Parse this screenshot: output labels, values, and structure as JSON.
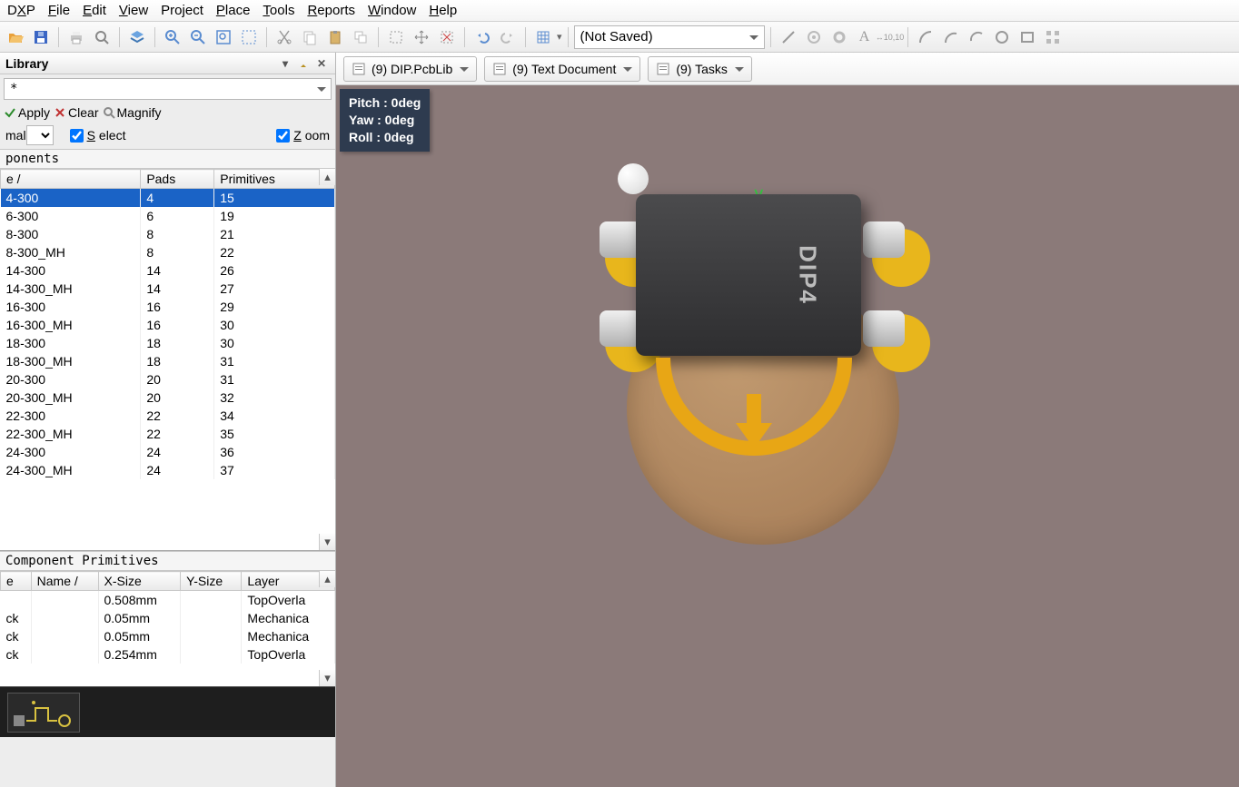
{
  "menu": {
    "items": [
      "DXP",
      "File",
      "Edit",
      "View",
      "Project",
      "Place",
      "Tools",
      "Reports",
      "Window",
      "Help"
    ]
  },
  "toolbar": {
    "saved_state": "(Not Saved)"
  },
  "library_panel": {
    "title": "Library",
    "mask": "*",
    "apply": "Apply",
    "clear": "Clear",
    "magnify": "Magnify",
    "mode_combo": "mal",
    "select": "Select",
    "zoom": "Zoom"
  },
  "components": {
    "section": "ponents",
    "headers": [
      "e",
      "Pads",
      "Primitives"
    ],
    "sort_col": 0,
    "rows": [
      {
        "name": "4-300",
        "pads": "4",
        "prim": "15",
        "selected": true
      },
      {
        "name": "6-300",
        "pads": "6",
        "prim": "19"
      },
      {
        "name": "8-300",
        "pads": "8",
        "prim": "21"
      },
      {
        "name": "8-300_MH",
        "pads": "8",
        "prim": "22"
      },
      {
        "name": "14-300",
        "pads": "14",
        "prim": "26"
      },
      {
        "name": "14-300_MH",
        "pads": "14",
        "prim": "27"
      },
      {
        "name": "16-300",
        "pads": "16",
        "prim": "29"
      },
      {
        "name": "16-300_MH",
        "pads": "16",
        "prim": "30"
      },
      {
        "name": "18-300",
        "pads": "18",
        "prim": "30"
      },
      {
        "name": "18-300_MH",
        "pads": "18",
        "prim": "31"
      },
      {
        "name": "20-300",
        "pads": "20",
        "prim": "31"
      },
      {
        "name": "20-300_MH",
        "pads": "20",
        "prim": "32"
      },
      {
        "name": "22-300",
        "pads": "22",
        "prim": "34"
      },
      {
        "name": "22-300_MH",
        "pads": "22",
        "prim": "35"
      },
      {
        "name": "24-300",
        "pads": "24",
        "prim": "36"
      },
      {
        "name": "24-300_MH",
        "pads": "24",
        "prim": "37"
      }
    ]
  },
  "primitives": {
    "section": "Component Primitives",
    "headers": [
      "e",
      "Name",
      "X-Size",
      "Y-Size",
      "Layer"
    ],
    "rows": [
      {
        "t": "",
        "name": "",
        "x": "0.508mm",
        "y": "",
        "layer": "TopOverla"
      },
      {
        "t": "ck",
        "name": "",
        "x": "0.05mm",
        "y": "",
        "layer": "Mechanica"
      },
      {
        "t": "ck",
        "name": "",
        "x": "0.05mm",
        "y": "",
        "layer": "Mechanica"
      },
      {
        "t": "ck",
        "name": "",
        "x": "0.254mm",
        "y": "",
        "layer": "TopOverla"
      }
    ]
  },
  "doc_tabs": [
    {
      "label": "(9) DIP.PcbLib",
      "icon": "pcblib"
    },
    {
      "label": "(9) Text Document",
      "icon": "text"
    },
    {
      "label": "(9) Tasks",
      "icon": "tasks"
    }
  ],
  "hud": {
    "pitch": "Pitch : 0deg",
    "yaw": "Yaw : 0deg",
    "roll": "Roll : 0deg"
  },
  "chip_label": "DIP4"
}
